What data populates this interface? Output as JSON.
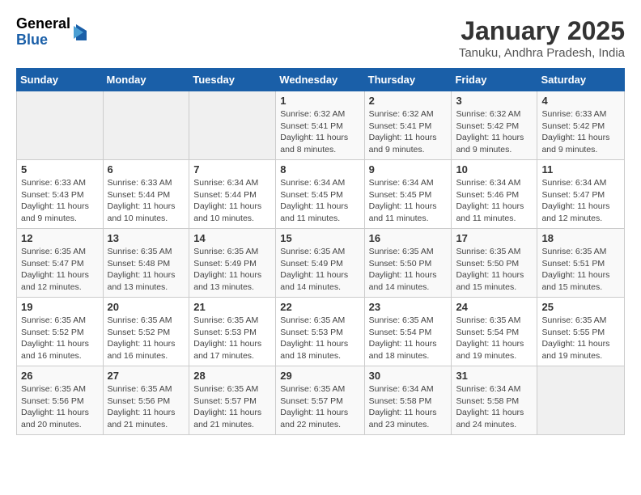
{
  "header": {
    "logo_general": "General",
    "logo_blue": "Blue",
    "month_title": "January 2025",
    "location": "Tanuku, Andhra Pradesh, India"
  },
  "days_of_week": [
    "Sunday",
    "Monday",
    "Tuesday",
    "Wednesday",
    "Thursday",
    "Friday",
    "Saturday"
  ],
  "weeks": [
    [
      {
        "num": "",
        "info": ""
      },
      {
        "num": "",
        "info": ""
      },
      {
        "num": "",
        "info": ""
      },
      {
        "num": "1",
        "info": "Sunrise: 6:32 AM\nSunset: 5:41 PM\nDaylight: 11 hours and 8 minutes."
      },
      {
        "num": "2",
        "info": "Sunrise: 6:32 AM\nSunset: 5:41 PM\nDaylight: 11 hours and 9 minutes."
      },
      {
        "num": "3",
        "info": "Sunrise: 6:32 AM\nSunset: 5:42 PM\nDaylight: 11 hours and 9 minutes."
      },
      {
        "num": "4",
        "info": "Sunrise: 6:33 AM\nSunset: 5:42 PM\nDaylight: 11 hours and 9 minutes."
      }
    ],
    [
      {
        "num": "5",
        "info": "Sunrise: 6:33 AM\nSunset: 5:43 PM\nDaylight: 11 hours and 9 minutes."
      },
      {
        "num": "6",
        "info": "Sunrise: 6:33 AM\nSunset: 5:44 PM\nDaylight: 11 hours and 10 minutes."
      },
      {
        "num": "7",
        "info": "Sunrise: 6:34 AM\nSunset: 5:44 PM\nDaylight: 11 hours and 10 minutes."
      },
      {
        "num": "8",
        "info": "Sunrise: 6:34 AM\nSunset: 5:45 PM\nDaylight: 11 hours and 11 minutes."
      },
      {
        "num": "9",
        "info": "Sunrise: 6:34 AM\nSunset: 5:45 PM\nDaylight: 11 hours and 11 minutes."
      },
      {
        "num": "10",
        "info": "Sunrise: 6:34 AM\nSunset: 5:46 PM\nDaylight: 11 hours and 11 minutes."
      },
      {
        "num": "11",
        "info": "Sunrise: 6:34 AM\nSunset: 5:47 PM\nDaylight: 11 hours and 12 minutes."
      }
    ],
    [
      {
        "num": "12",
        "info": "Sunrise: 6:35 AM\nSunset: 5:47 PM\nDaylight: 11 hours and 12 minutes."
      },
      {
        "num": "13",
        "info": "Sunrise: 6:35 AM\nSunset: 5:48 PM\nDaylight: 11 hours and 13 minutes."
      },
      {
        "num": "14",
        "info": "Sunrise: 6:35 AM\nSunset: 5:49 PM\nDaylight: 11 hours and 13 minutes."
      },
      {
        "num": "15",
        "info": "Sunrise: 6:35 AM\nSunset: 5:49 PM\nDaylight: 11 hours and 14 minutes."
      },
      {
        "num": "16",
        "info": "Sunrise: 6:35 AM\nSunset: 5:50 PM\nDaylight: 11 hours and 14 minutes."
      },
      {
        "num": "17",
        "info": "Sunrise: 6:35 AM\nSunset: 5:50 PM\nDaylight: 11 hours and 15 minutes."
      },
      {
        "num": "18",
        "info": "Sunrise: 6:35 AM\nSunset: 5:51 PM\nDaylight: 11 hours and 15 minutes."
      }
    ],
    [
      {
        "num": "19",
        "info": "Sunrise: 6:35 AM\nSunset: 5:52 PM\nDaylight: 11 hours and 16 minutes."
      },
      {
        "num": "20",
        "info": "Sunrise: 6:35 AM\nSunset: 5:52 PM\nDaylight: 11 hours and 16 minutes."
      },
      {
        "num": "21",
        "info": "Sunrise: 6:35 AM\nSunset: 5:53 PM\nDaylight: 11 hours and 17 minutes."
      },
      {
        "num": "22",
        "info": "Sunrise: 6:35 AM\nSunset: 5:53 PM\nDaylight: 11 hours and 18 minutes."
      },
      {
        "num": "23",
        "info": "Sunrise: 6:35 AM\nSunset: 5:54 PM\nDaylight: 11 hours and 18 minutes."
      },
      {
        "num": "24",
        "info": "Sunrise: 6:35 AM\nSunset: 5:54 PM\nDaylight: 11 hours and 19 minutes."
      },
      {
        "num": "25",
        "info": "Sunrise: 6:35 AM\nSunset: 5:55 PM\nDaylight: 11 hours and 19 minutes."
      }
    ],
    [
      {
        "num": "26",
        "info": "Sunrise: 6:35 AM\nSunset: 5:56 PM\nDaylight: 11 hours and 20 minutes."
      },
      {
        "num": "27",
        "info": "Sunrise: 6:35 AM\nSunset: 5:56 PM\nDaylight: 11 hours and 21 minutes."
      },
      {
        "num": "28",
        "info": "Sunrise: 6:35 AM\nSunset: 5:57 PM\nDaylight: 11 hours and 21 minutes."
      },
      {
        "num": "29",
        "info": "Sunrise: 6:35 AM\nSunset: 5:57 PM\nDaylight: 11 hours and 22 minutes."
      },
      {
        "num": "30",
        "info": "Sunrise: 6:34 AM\nSunset: 5:58 PM\nDaylight: 11 hours and 23 minutes."
      },
      {
        "num": "31",
        "info": "Sunrise: 6:34 AM\nSunset: 5:58 PM\nDaylight: 11 hours and 24 minutes."
      },
      {
        "num": "",
        "info": ""
      }
    ]
  ]
}
